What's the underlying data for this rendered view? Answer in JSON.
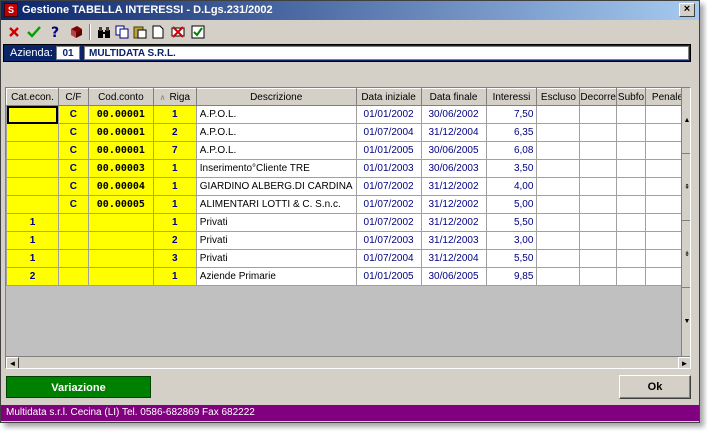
{
  "window": {
    "title": "Gestione TABELLA INTERESSI - D.Lgs.231/2002",
    "icon_text": "S",
    "close_symbol": "×"
  },
  "toolbar": {
    "buttons": [
      {
        "name": "cancel-icon",
        "color": "#d00000"
      },
      {
        "name": "confirm-icon",
        "color": "#00a000"
      },
      {
        "name": "help-icon",
        "color": "#000080"
      },
      {
        "name": "book-icon",
        "color": "#800000"
      },
      {
        "name": "binoculars-icon",
        "color": "#000000"
      },
      {
        "name": "copy-icon",
        "color": "#000080"
      },
      {
        "name": "paste-icon",
        "color": "#808000"
      },
      {
        "name": "new-document-icon",
        "color": "#ffffff"
      },
      {
        "name": "delete-icon",
        "color": "#d00000"
      },
      {
        "name": "checkbox-icon",
        "color": "#008000"
      }
    ]
  },
  "azienda": {
    "label": "Azienda:",
    "code": "01",
    "name": "MULTIDATA S.R.L."
  },
  "table": {
    "columns": [
      "Cat.econ.",
      "C/F",
      "Cod.conto",
      "Riga",
      "Descrizione",
      "Data iniziale",
      "Data finale",
      "Interessi",
      "Escluso",
      "Decorre",
      "Subfo",
      "Penale"
    ],
    "sort_marker": "∧",
    "rows": [
      {
        "cat": "",
        "cf": "C",
        "conto": "00.00001",
        "riga": "1",
        "desc": "A.P.O.L.",
        "dini": "01/01/2002",
        "dfin": "30/06/2002",
        "int": "7,50"
      },
      {
        "cat": "",
        "cf": "C",
        "conto": "00.00001",
        "riga": "2",
        "desc": "A.P.O.L.",
        "dini": "01/07/2004",
        "dfin": "31/12/2004",
        "int": "6,35"
      },
      {
        "cat": "",
        "cf": "C",
        "conto": "00.00001",
        "riga": "7",
        "desc": "A.P.O.L.",
        "dini": "01/01/2005",
        "dfin": "30/06/2005",
        "int": "6,08"
      },
      {
        "cat": "",
        "cf": "C",
        "conto": "00.00003",
        "riga": "1",
        "desc": "Inserimento°Cliente TRE",
        "dini": "01/01/2003",
        "dfin": "30/06/2003",
        "int": "3,50"
      },
      {
        "cat": "",
        "cf": "C",
        "conto": "00.00004",
        "riga": "1",
        "desc": "GIARDINO ALBERG.DI CARDINA",
        "dini": "01/07/2002",
        "dfin": "31/12/2002",
        "int": "4,00"
      },
      {
        "cat": "",
        "cf": "C",
        "conto": "00.00005",
        "riga": "1",
        "desc": "ALIMENTARI LOTTI & C. S.n.c.",
        "dini": "01/07/2002",
        "dfin": "31/12/2002",
        "int": "5,00"
      },
      {
        "cat": "1",
        "cf": "",
        "conto": "",
        "riga": "1",
        "desc": "Privati",
        "dini": "01/07/2002",
        "dfin": "31/12/2002",
        "int": "5,50"
      },
      {
        "cat": "1",
        "cf": "",
        "conto": "",
        "riga": "2",
        "desc": "Privati",
        "dini": "01/07/2003",
        "dfin": "31/12/2003",
        "int": "3,00"
      },
      {
        "cat": "1",
        "cf": "",
        "conto": "",
        "riga": "3",
        "desc": "Privati",
        "dini": "01/07/2004",
        "dfin": "31/12/2004",
        "int": "5,50"
      },
      {
        "cat": "2",
        "cf": "",
        "conto": "",
        "riga": "1",
        "desc": "Aziende Primarie",
        "dini": "01/01/2005",
        "dfin": "30/06/2005",
        "int": "9,85"
      }
    ]
  },
  "scrollbar": {
    "up": "▲",
    "page_up": "⇞",
    "page_down": "⇟",
    "down": "▼",
    "left": "◄",
    "right": "►"
  },
  "buttons": {
    "variazione": "Variazione",
    "ok": "Ok"
  },
  "status": "Multidata s.r.l. Cecina (LI) Tel. 0586-682869  Fax 682222",
  "colors": {
    "accent": "#0a246a",
    "yellow_cells": "#ffff00",
    "status_bar": "#800080",
    "variazione": "#008000"
  }
}
